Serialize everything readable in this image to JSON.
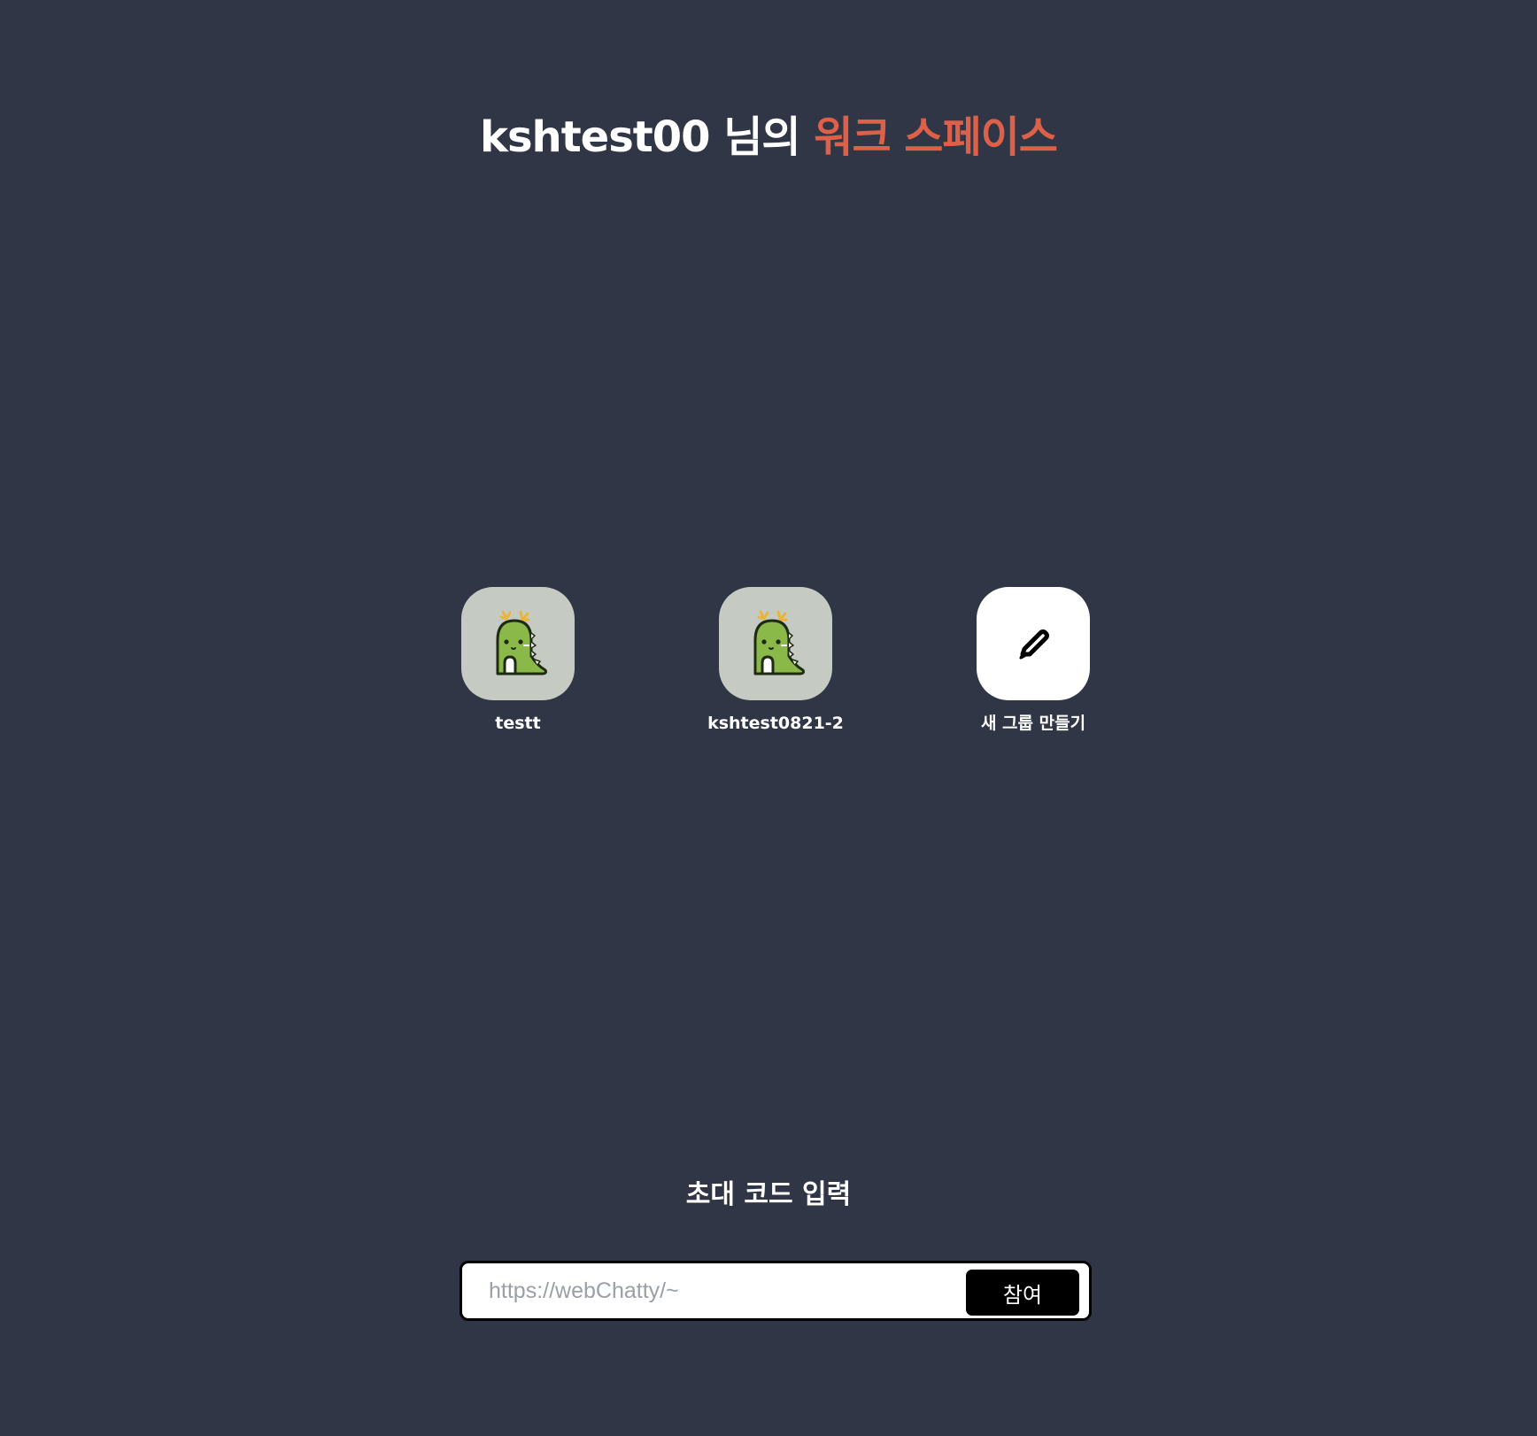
{
  "header": {
    "title_prefix": "kshtest00 님의",
    "title_accent": "워크 스페이스"
  },
  "groups": [
    {
      "label": "testt",
      "icon": "dinosaur-avatar-icon"
    },
    {
      "label": "kshtest0821-2",
      "icon": "dinosaur-avatar-icon"
    },
    {
      "label": "새 그룹 만들기",
      "icon": "pencil-icon"
    }
  ],
  "invite": {
    "heading": "초대 코드 입력",
    "placeholder": "https://webChatty/~",
    "value": "",
    "join_label": "참여"
  },
  "colors": {
    "background": "#313646",
    "accent": "#dd6048",
    "tile": "#c5cbc3"
  }
}
